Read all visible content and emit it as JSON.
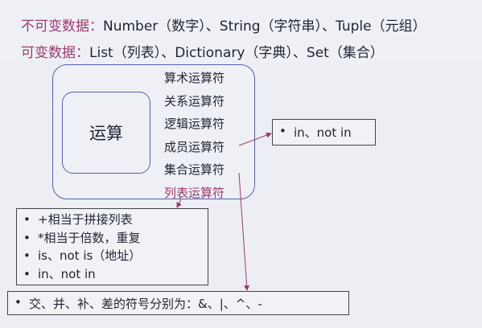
{
  "header": {
    "immutable_label": "不可变数据：",
    "immutable_text": "Number（数字）、String（字符串）、Tuple（元组）",
    "mutable_label": "可变数据：",
    "mutable_text": "List（列表）、Dictionary（字典）、Set（集合）"
  },
  "core": {
    "label": "运算"
  },
  "operators": [
    "算术运算符",
    "关系运算符",
    "逻辑运算符",
    "成员运算符",
    "集合运算符",
    "列表运算符"
  ],
  "member_note": {
    "bullet": "•",
    "text": "in、not in"
  },
  "list_notes": [
    {
      "bullet": "•",
      "text": "+相当于拼接列表"
    },
    {
      "bullet": "•",
      "text": "*相当于倍数，重复"
    },
    {
      "bullet": "•",
      "text": "is、not is（地址）"
    },
    {
      "bullet": "•",
      "text": "in、not in"
    }
  ],
  "set_note": {
    "bullet": "•",
    "text": "交、并、补、差的符号分别为：&、|、^、-"
  },
  "colors": {
    "accent": "#9b3a6e",
    "box_border": "#5561a8"
  }
}
